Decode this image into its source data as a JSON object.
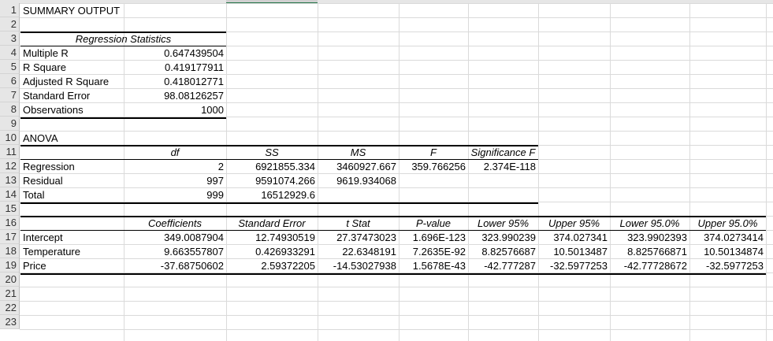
{
  "rows": [
    "1",
    "2",
    "3",
    "4",
    "5",
    "6",
    "7",
    "8",
    "9",
    "10",
    "11",
    "12",
    "13",
    "14",
    "15",
    "16",
    "17",
    "18",
    "19",
    "20",
    "21",
    "22",
    "23"
  ],
  "summary_title": "SUMMARY OUTPUT",
  "regression_statistics": {
    "header": "Regression Statistics",
    "items": [
      {
        "label": "Multiple R",
        "value": "0.647439504"
      },
      {
        "label": "R Square",
        "value": "0.419177911"
      },
      {
        "label": "Adjusted R Square",
        "value": "0.418012771"
      },
      {
        "label": "Standard Error",
        "value": "98.08126257"
      },
      {
        "label": "Observations",
        "value": "1000"
      }
    ]
  },
  "anova": {
    "title": "ANOVA",
    "headers": [
      "",
      "df",
      "SS",
      "MS",
      "F",
      "Significance F"
    ],
    "rows": [
      [
        "Regression",
        "2",
        "6921855.334",
        "3460927.667",
        "359.766256",
        "2.374E-118"
      ],
      [
        "Residual",
        "997",
        "9591074.266",
        "9619.934068",
        "",
        ""
      ],
      [
        "Total",
        "999",
        "16512929.6",
        "",
        "",
        ""
      ]
    ]
  },
  "coefficients": {
    "headers": [
      "",
      "Coefficients",
      "Standard Error",
      "t Stat",
      "P-value",
      "Lower 95%",
      "Upper 95%",
      "Lower 95.0%",
      "Upper 95.0%"
    ],
    "rows": [
      [
        "Intercept",
        "349.0087904",
        "12.74930519",
        "27.37473023",
        "1.696E-123",
        "323.990239",
        "374.027341",
        "323.9902393",
        "374.0273414"
      ],
      [
        "Temperature",
        "9.663557807",
        "0.426933291",
        "22.6348191",
        "7.2635E-92",
        "8.82576687",
        "10.5013487",
        "8.825766871",
        "10.50134874"
      ],
      [
        "Price",
        "-37.68750602",
        "2.59372205",
        "-14.53027938",
        "1.5678E-43",
        "-42.777287",
        "-32.5977253",
        "-42.77728672",
        "-32.5977253"
      ]
    ]
  }
}
